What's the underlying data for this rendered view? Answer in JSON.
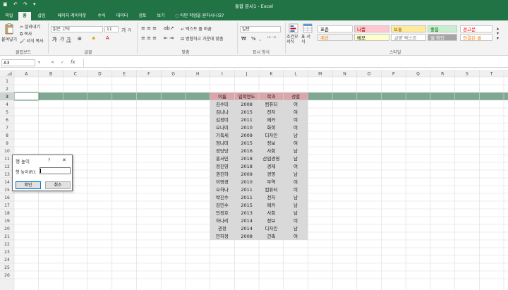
{
  "window": {
    "title": "통합 문서1 - Excel",
    "qat_text": "▣ ↶ ↷ ▾"
  },
  "tabs": [
    "파일",
    "홈",
    "삽입",
    "페이지 레이아웃",
    "수식",
    "데이터",
    "검토",
    "보기"
  ],
  "active_tab": "홈",
  "tell_me": "어떤 작업을 원하시나요?",
  "ribbon": {
    "clipboard": {
      "paste": "붙여넣기",
      "cut": "잘라내기",
      "copy": "복사",
      "format_painter": "서식 복사",
      "label": "클립보드"
    },
    "font": {
      "name": "맑은 고딕",
      "size": "11",
      "grow": "가",
      "shrink": "가",
      "bold": "가",
      "italic": "가",
      "underline": "가",
      "label": "글꼴"
    },
    "alignment": {
      "wrap": "텍스트 줄 바꿈",
      "merge": "병합하고 가운데 맞춤",
      "label": "맞춤"
    },
    "number": {
      "format": "일반",
      "percent": "%",
      "comma": ",",
      "label": "표시 형식"
    },
    "styles_group": {
      "conditional": "조건부 서식",
      "table": "표 서식",
      "label": "스타일",
      "items": [
        {
          "name": "표준",
          "bg": "#ffffff",
          "fg": "#000000"
        },
        {
          "name": "나쁨",
          "bg": "#ffc7ce",
          "fg": "#9c0006"
        },
        {
          "name": "보통",
          "bg": "#ffeb9c",
          "fg": "#9c5700"
        },
        {
          "name": "좋음",
          "bg": "#c6efce",
          "fg": "#006100"
        },
        {
          "name": "경고문",
          "bg": "#ffffff",
          "fg": "#ff0000"
        },
        {
          "name": "계산",
          "bg": "#f2f2f2",
          "fg": "#fa7d00"
        },
        {
          "name": "메모",
          "bg": "#ffffcc",
          "fg": "#000000"
        },
        {
          "name": "설명 텍스트",
          "bg": "#ffffff",
          "fg": "#7f7f7f"
        },
        {
          "name": "셀 확인",
          "bg": "#a5a5a5",
          "fg": "#ffffff"
        },
        {
          "name": "연결된 셀",
          "bg": "#ffffff",
          "fg": "#fa7d00"
        }
      ]
    }
  },
  "formula_bar": {
    "name_box": "A3",
    "fx": "fx",
    "cancel": "✕",
    "confirm": "✓"
  },
  "columns": [
    "A",
    "B",
    "C",
    "D",
    "E",
    "F",
    "G",
    "H",
    "I",
    "J",
    "K",
    "L",
    "M",
    "N",
    "O",
    "P",
    "Q",
    "R",
    "S",
    "T"
  ],
  "rows": [
    "1",
    "2",
    "3",
    "4",
    "5",
    "6",
    "7",
    "8",
    "9",
    "10",
    "11",
    "12",
    "13",
    "14",
    "15",
    "16",
    "17",
    "18",
    "19",
    "20",
    "21",
    "22",
    "23",
    "24",
    "25",
    "26"
  ],
  "table": {
    "headers": [
      "이름",
      "입학연도",
      "학과",
      "성별"
    ],
    "rows": [
      [
        "김수미",
        "2008",
        "컴퓨터",
        "여"
      ],
      [
        "김나나",
        "2015",
        "전자",
        "여"
      ],
      [
        "김정미",
        "2011",
        "메카",
        "여"
      ],
      [
        "오나미",
        "2010",
        "화학",
        "여"
      ],
      [
        "기독세",
        "2009",
        "디자인",
        "남"
      ],
      [
        "정나미",
        "2015",
        "정보",
        "여"
      ],
      [
        "정당당",
        "2016",
        "사회",
        "남"
      ],
      [
        "홍서민",
        "2018",
        "산업경영",
        "남"
      ],
      [
        "정진영",
        "2018",
        "경제",
        "여"
      ],
      [
        "권진하",
        "2009",
        "경영",
        "남"
      ],
      [
        "이영경",
        "2010",
        "무역",
        "여"
      ],
      [
        "오하나",
        "2011",
        "컴퓨터",
        "여"
      ],
      [
        "박진수",
        "2011",
        "전자",
        "남"
      ],
      [
        "김민수",
        "2015",
        "메카",
        "남"
      ],
      [
        "민정호",
        "2013",
        "사회",
        "남"
      ],
      [
        "하나리",
        "2014",
        "정보",
        "여"
      ],
      [
        "권정",
        "2014",
        "디자인",
        "남"
      ],
      [
        "민하정",
        "2008",
        "건축",
        "여"
      ]
    ]
  },
  "dialog": {
    "title": "행 높이",
    "help": "?",
    "close": "✕",
    "field_label": "행 높이(R):",
    "field_value": "",
    "ok": "확인",
    "cancel": "취소"
  },
  "colors": {
    "excel_green": "#217346",
    "header_fill": "#d9a6ab",
    "data_fill": "#d9d9d9",
    "selected_row": "#7fa892"
  }
}
